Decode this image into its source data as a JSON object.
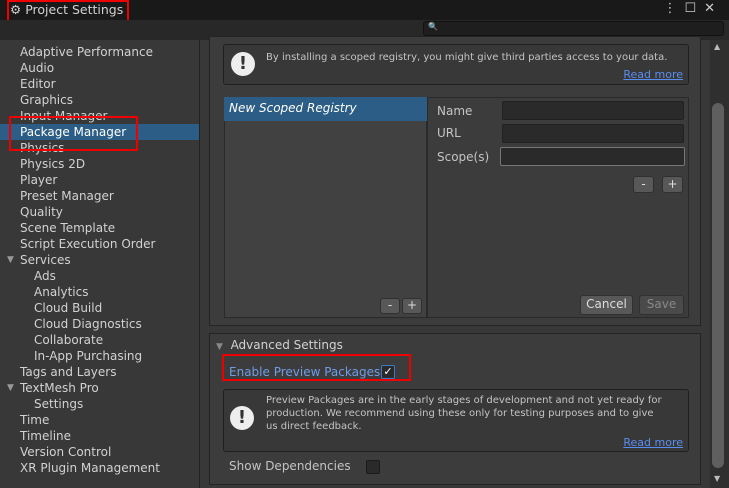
{
  "window": {
    "title": "Project Settings",
    "search_placeholder": ""
  },
  "sidebar": {
    "items": [
      "Adaptive Performance",
      "Audio",
      "Editor",
      "Graphics",
      "Input Manager",
      "Package Manager",
      "Physics",
      "Physics 2D",
      "Player",
      "Preset Manager",
      "Quality",
      "Scene Template",
      "Script Execution Order",
      "Services",
      "Ads",
      "Analytics",
      "Cloud Build",
      "Cloud Diagnostics",
      "Collaborate",
      "In-App Purchasing",
      "Tags and Layers",
      "TextMesh Pro",
      "Settings",
      "Time",
      "Timeline",
      "Version Control",
      "XR Plugin Management"
    ],
    "selected": "Package Manager"
  },
  "registry": {
    "warning": "By installing a scoped registry, you might give third parties access to your data.",
    "read_more": "Read more",
    "list": [
      "New Scoped Registry"
    ],
    "name_label": "Name",
    "url_label": "URL",
    "scopes_label": "Scope(s)",
    "name_value": "",
    "url_value": "",
    "scopes_value": "",
    "minus": "-",
    "plus": "+",
    "cancel": "Cancel",
    "save": "Save"
  },
  "advanced": {
    "title": "Advanced Settings",
    "enable_preview": "Enable Preview Packages",
    "enable_preview_checked": true,
    "preview_info": "Preview Packages are in the early stages of development and not yet ready for production. We recommend using these only for testing purposes and to give us direct feedback.",
    "read_more": "Read more",
    "show_deps": "Show Dependencies",
    "show_deps_checked": false
  }
}
